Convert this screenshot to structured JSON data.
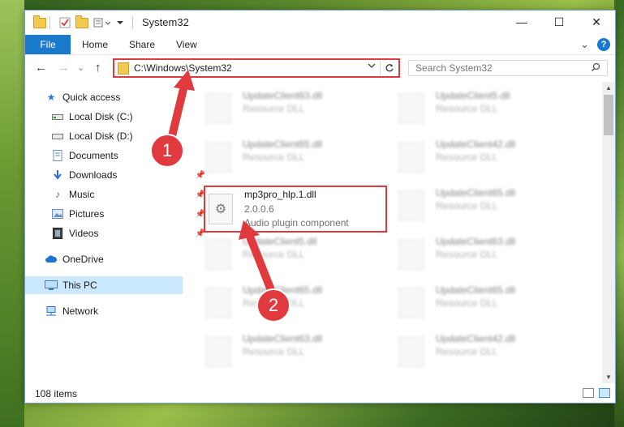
{
  "window": {
    "title": "System32",
    "controls": {
      "minimize": "—",
      "maximize": "☐",
      "close": "✕"
    }
  },
  "ribbon": {
    "tabs": [
      "File",
      "Home",
      "Share",
      "View"
    ],
    "help": "?",
    "collapse": "⌄"
  },
  "navigation": {
    "back": "←",
    "forward": "→",
    "recent": "⌄",
    "up": "↑",
    "address": "C:\\Windows\\System32",
    "search_placeholder": "Search System32"
  },
  "sidebar": {
    "items": [
      {
        "label": "Quick access",
        "icon": "star-icon",
        "pinned": false
      },
      {
        "label": "Local Disk (C:)",
        "icon": "drive-icon",
        "pinned": false
      },
      {
        "label": "Local Disk (D:)",
        "icon": "drive-icon",
        "pinned": false
      },
      {
        "label": "Documents",
        "icon": "documents-icon",
        "pinned": false
      },
      {
        "label": "Downloads",
        "icon": "download-icon",
        "pinned": true
      },
      {
        "label": "Music",
        "icon": "music-icon",
        "pinned": true
      },
      {
        "label": "Pictures",
        "icon": "pictures-icon",
        "pinned": true
      },
      {
        "label": "Videos",
        "icon": "videos-icon",
        "pinned": true
      },
      {
        "label": "OneDrive",
        "icon": "cloud-icon",
        "pinned": false
      },
      {
        "label": "This PC",
        "icon": "computer-icon",
        "pinned": false,
        "selected": true
      },
      {
        "label": "Network",
        "icon": "network-icon",
        "pinned": false
      }
    ]
  },
  "files": {
    "left": [
      {
        "name": "UpdateClient63.dll",
        "type": "Resource DLL"
      },
      {
        "name": "UpdateClient65.dll",
        "type": "Resource DLL"
      },
      {
        "name": "UpdateClient5.dll",
        "type": "Resource DLL"
      },
      {
        "name": "UpdateClient65.dll",
        "type": "Resource DLL"
      },
      {
        "name": "UpdateClient63.dll",
        "type": "Resource DLL"
      }
    ],
    "right": [
      {
        "name": "UpdateClient5.dll",
        "type": "Resource DLL"
      },
      {
        "name": "UpdateClient42.dll",
        "type": "Resource DLL"
      },
      {
        "name": "UpdateClient65.dll",
        "type": "Resource DLL"
      },
      {
        "name": "UpdateClient63.dll",
        "type": "Resource DLL"
      },
      {
        "name": "UpdateClient65.dll",
        "type": "Resource DLL"
      },
      {
        "name": "UpdateClient42.dll",
        "type": "Resource DLL"
      }
    ],
    "highlighted": {
      "name": "mp3pro_hlp.1.dll",
      "version": "2.0.0.6",
      "description": "Audio plugin component"
    }
  },
  "status": {
    "item_count": "108 items"
  },
  "annotations": {
    "marker1": "1",
    "marker2": "2",
    "color": "#e0393e"
  }
}
